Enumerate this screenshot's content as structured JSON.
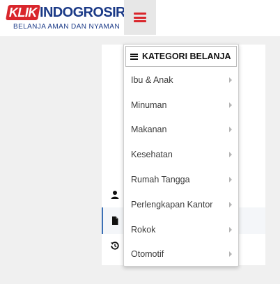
{
  "header": {
    "logo_badge": "KLIK",
    "logo_word": "INDOGROSIR",
    "tagline": "BELANJA AMAN DAN NYAMAN",
    "menu_icon": "hamburger-icon"
  },
  "sidebar_icons": [
    "user-icon",
    "document-icon",
    "history-icon"
  ],
  "dropdown": {
    "title": "KATEGORI BELANJA",
    "title_icon": "hamburger-icon",
    "items": [
      {
        "label": "Ibu & Anak"
      },
      {
        "label": "Minuman"
      },
      {
        "label": "Makanan"
      },
      {
        "label": "Kesehatan"
      },
      {
        "label": "Rumah Tangga"
      },
      {
        "label": "Perlengkapan Kantor"
      },
      {
        "label": "Rokok"
      },
      {
        "label": "Otomotif"
      }
    ]
  },
  "colors": {
    "brand_red": "#d9262c",
    "brand_blue": "#1b3a87",
    "highlight_border": "#3a6fb5"
  }
}
